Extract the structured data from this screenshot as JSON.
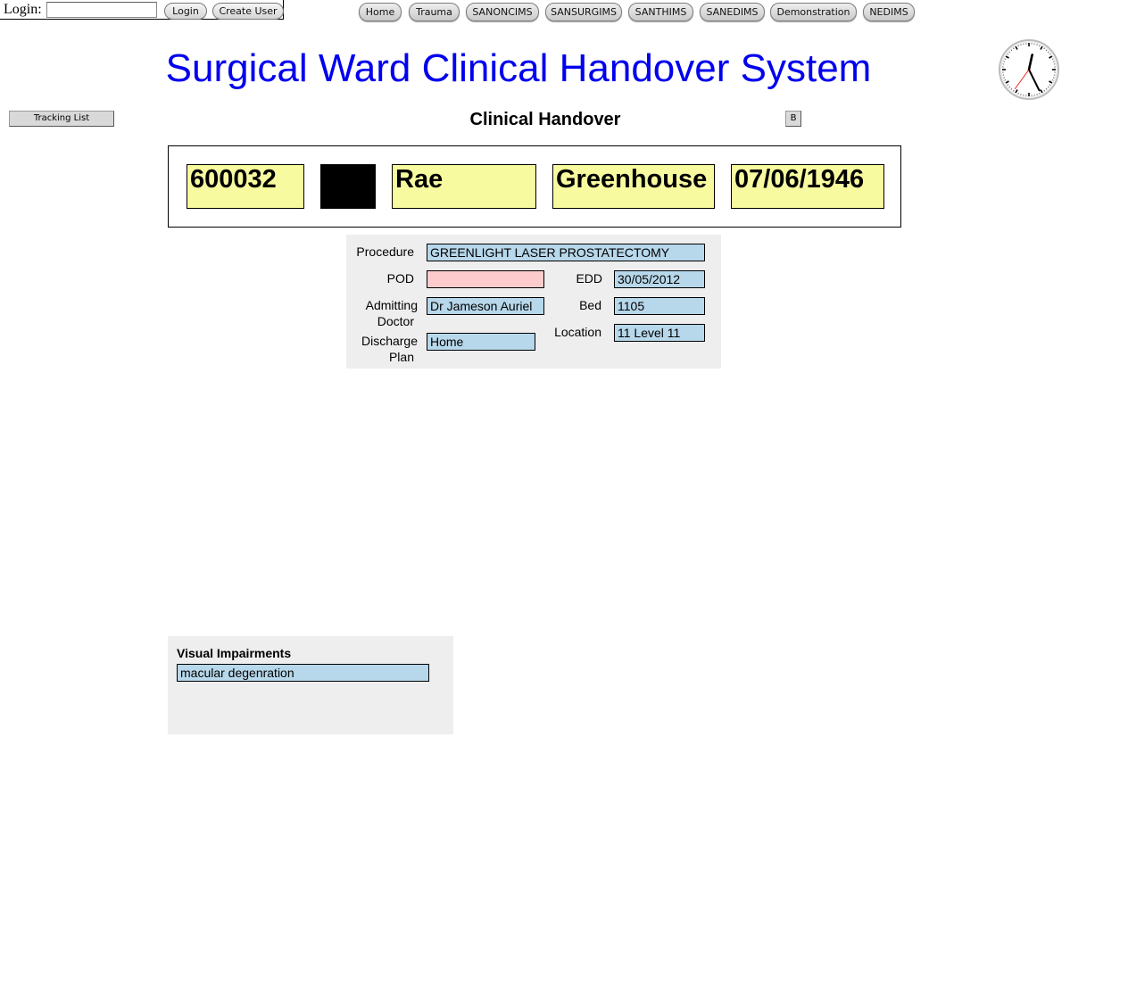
{
  "login": {
    "label": "Login:",
    "username_value": "",
    "login_button": "Login",
    "create_user_button": "Create User"
  },
  "nav": {
    "items": [
      "Home",
      "Trauma",
      "SANONCIMS",
      "SANSURGIMS",
      "SANTHIMS",
      "SANEDIMS",
      "Demonstration",
      "NEDIMS"
    ]
  },
  "page": {
    "title": "Surgical Ward Clinical Handover System",
    "section_heading": "Clinical Handover",
    "tracking_list_button": "Tracking List",
    "b_button": "B",
    "title_color": "#0000ee"
  },
  "clock": {
    "hour": 12,
    "minute": 25,
    "second": 36
  },
  "patient": {
    "id": "600032",
    "first_name": "Rae",
    "surname": "Greenhouse",
    "dob": "07/06/1946",
    "banner_color": "#f8fa9f"
  },
  "details": {
    "procedure_label": "Procedure",
    "procedure": "GREENLIGHT LASER PROSTATECTOMY",
    "pod_label": "POD",
    "pod": "",
    "edd_label": "EDD",
    "edd": "30/05/2012",
    "admitting_doctor_label_1": "Admitting",
    "admitting_doctor_label_2": "Doctor",
    "admitting_doctor": "Dr Jameson Auriel",
    "bed_label": "Bed",
    "bed": "1105",
    "discharge_plan_label_1": "Discharge",
    "discharge_plan_label_2": "Plan",
    "discharge_plan": "Home",
    "location_label": "Location",
    "location": "11 Level 11",
    "field_color": "#b7d7ea",
    "pod_color": "#fecbcd"
  },
  "visual_impairments": {
    "heading": "Visual Impairments",
    "value": "macular degenration"
  }
}
